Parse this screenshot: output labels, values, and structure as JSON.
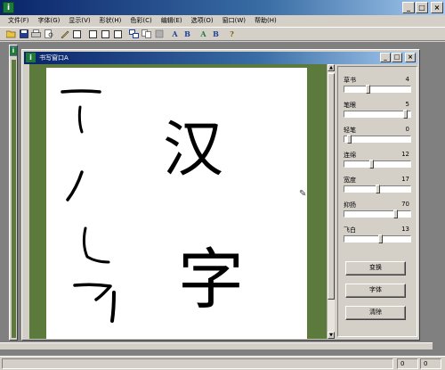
{
  "app": {
    "icon_letter": "i"
  },
  "menu": [
    "文件(F)",
    "字体(G)",
    "显示(V)",
    "形状(H)",
    "色彩(C)",
    "编辑(E)",
    "选项(O)",
    "窗口(W)",
    "帮助(H)"
  ],
  "toolbar": {
    "text_buttons": [
      "A",
      "B",
      "A",
      "B",
      "?"
    ]
  },
  "child_window": {
    "title": "书写窗口A",
    "icon_letter": "i"
  },
  "background_window": {
    "icon_letter": "i"
  },
  "canvas_text": [
    "汉",
    "字"
  ],
  "params": [
    {
      "label": "草书",
      "value": "4",
      "level": 0.35
    },
    {
      "label": "笔眼",
      "value": "5",
      "level": 0.95
    },
    {
      "label": "轻笔",
      "value": "0",
      "level": 0.05
    },
    {
      "label": "连绵",
      "value": "12",
      "level": 0.4
    },
    {
      "label": "宽度",
      "value": "17",
      "level": 0.5
    },
    {
      "label": "抑扬",
      "value": "70",
      "level": 0.8
    },
    {
      "label": "飞白",
      "value": "13",
      "level": 0.55
    }
  ],
  "buttons": {
    "convert": "变换",
    "font": "字体",
    "clear": "清除"
  },
  "status": {
    "pane1": "0",
    "pane2": "0"
  },
  "colors": {
    "title_active": "#0a246a",
    "canvas_border": "#5b7a3c"
  }
}
